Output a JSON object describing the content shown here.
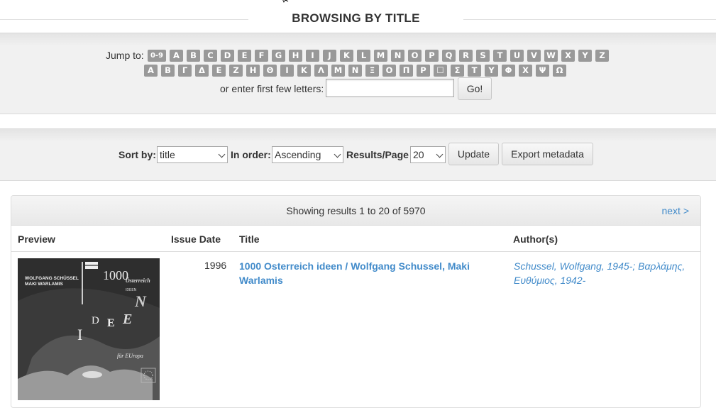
{
  "page": {
    "title": "BROWSING BY TITLE"
  },
  "jump": {
    "label": "Jump to:",
    "latin": [
      "0-9",
      "A",
      "B",
      "C",
      "D",
      "E",
      "F",
      "G",
      "H",
      "I",
      "J",
      "K",
      "L",
      "M",
      "N",
      "O",
      "P",
      "Q",
      "R",
      "S",
      "T",
      "U",
      "V",
      "W",
      "X",
      "Y",
      "Z"
    ],
    "greek": [
      "Α",
      "Β",
      "Γ",
      "Δ",
      "Ε",
      "Ζ",
      "Η",
      "Θ",
      "Ι",
      "Κ",
      "Λ",
      "Μ",
      "Ν",
      "Ξ",
      "Ο",
      "Π",
      "Ρ",
      "☐",
      "Σ",
      "Τ",
      "Υ",
      "Φ",
      "Χ",
      "Ψ",
      "Ω"
    ],
    "enter_label": "or enter first few letters:",
    "input_value": "",
    "go_label": "Go!"
  },
  "sort": {
    "sort_by_label": "Sort by:",
    "sort_by_value": "title",
    "order_label": "In order:",
    "order_value": "Ascending",
    "rpp_label": "Results/Page",
    "rpp_value": "20",
    "update_label": "Update",
    "export_label": "Export metadata"
  },
  "results": {
    "showing": "Showing results 1 to 20 of 5970",
    "next": "next >",
    "headers": {
      "preview": "Preview",
      "issue_date": "Issue Date",
      "title": "Title",
      "authors": "Author(s)"
    },
    "rows": [
      {
        "date": "1996",
        "title": "1000 Osterreich ideen / Wolfgang Schussel, Maki Warlamis",
        "authors": [
          "Schussel, Wolfgang, 1945-",
          "Βαρλάμης, Ευθύμιος, 1942-"
        ],
        "thumbnail": {
          "authors": [
            "WOLFGANG SCHÜSSEL",
            "MAKI WARLAMIS"
          ],
          "number": "1000",
          "word": "Österreich",
          "ideen": "IDEEN",
          "fur": "für EUropa"
        }
      }
    ]
  }
}
